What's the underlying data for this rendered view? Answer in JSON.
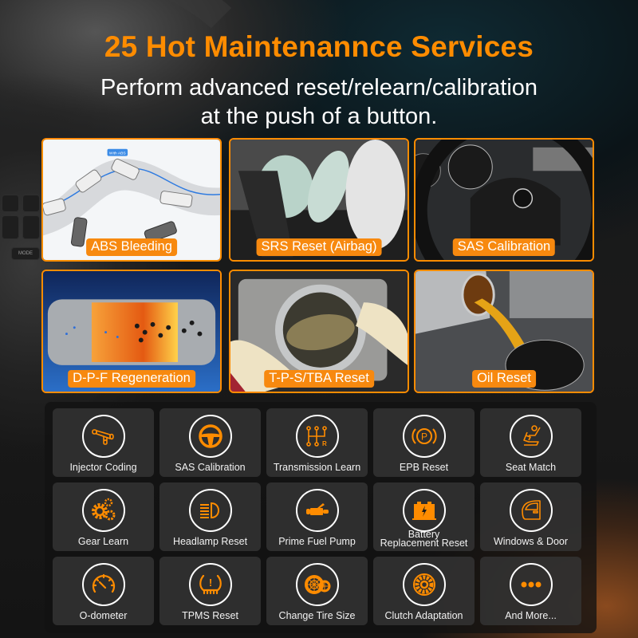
{
  "header": {
    "title": "25 Hot Maintenannce Services",
    "subtitle_line1": "Perform advanced reset/relearn/calibration",
    "subtitle_line2": "at the push of a button."
  },
  "colors": {
    "accent": "#ff8c00",
    "label_bg": "#f7890f",
    "card_bg": "#343434",
    "text": "#ffffff"
  },
  "background_console_labels": [
    "MODE"
  ],
  "featured": [
    {
      "label": "ABS Bleeding",
      "image_badge": "With ABS"
    },
    {
      "label": "SRS Reset (Airbag)"
    },
    {
      "label": "SAS Calibration"
    },
    {
      "label": "D-P-F Regeneration"
    },
    {
      "label": "T-P-S/TBA Reset"
    },
    {
      "label": "Oil Reset"
    }
  ],
  "services": [
    {
      "label": "Injector Coding",
      "icon": "injector-icon"
    },
    {
      "label": "SAS Calibration",
      "icon": "steering-wheel-icon"
    },
    {
      "label": "Transmission Learn",
      "icon": "gear-shift-icon",
      "icon_text": "R"
    },
    {
      "label": "EPB Reset",
      "icon": "parking-brake-icon",
      "icon_text": "P"
    },
    {
      "label": "Seat Match",
      "icon": "seat-icon"
    },
    {
      "label": "Gear Learn",
      "icon": "gears-icon"
    },
    {
      "label": "Headlamp Reset",
      "icon": "headlamp-icon"
    },
    {
      "label": "Prime Fuel Pump",
      "icon": "fuel-pump-icon"
    },
    {
      "label": "Battery Replacement Reset",
      "label_line1": "Battery",
      "label_line2": "Replacement Reset",
      "icon": "battery-icon"
    },
    {
      "label": "Windows & Door",
      "icon": "car-door-icon"
    },
    {
      "label": "O-dometer",
      "icon": "odometer-icon"
    },
    {
      "label": "TPMS Reset",
      "icon": "tpms-icon",
      "icon_text": "!"
    },
    {
      "label": "Change Tire Size",
      "icon": "tire-icon"
    },
    {
      "label": "Clutch Adaptation",
      "icon": "clutch-icon"
    },
    {
      "label": "And More...",
      "icon": "more-icon"
    }
  ]
}
